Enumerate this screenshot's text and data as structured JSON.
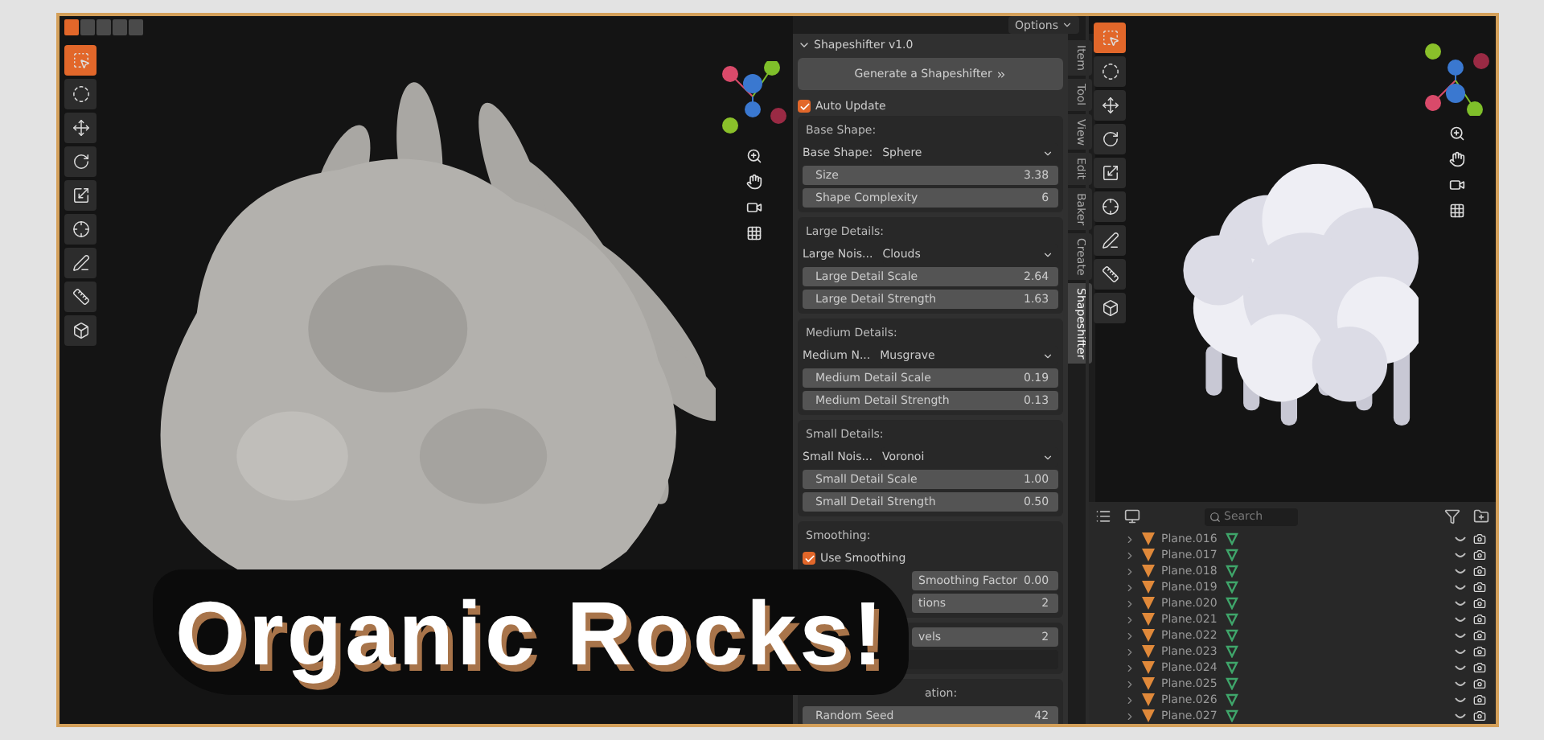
{
  "viewport_left": {
    "modes": [
      {
        "selected": true
      },
      {
        "selected": false
      },
      {
        "selected": false
      },
      {
        "selected": false
      },
      {
        "selected": false
      }
    ],
    "tools": [
      {
        "selected": true
      },
      {
        "selected": false
      },
      {
        "selected": false
      },
      {
        "selected": false
      },
      {
        "selected": false
      },
      {
        "selected": false
      },
      {
        "selected": false
      },
      {
        "selected": false
      },
      {
        "selected": false
      }
    ]
  },
  "options_button": "Options",
  "panel": {
    "title": "Shapeshifter v1.0",
    "expanded": true,
    "generate_button": "Generate a Shapeshifter",
    "auto_update": {
      "label": "Auto Update",
      "checked": true
    },
    "sections": [
      {
        "title": "Base Shape:",
        "rows": [
          {
            "kind": "dropdown",
            "label": "Base Shape:",
            "value": "Sphere"
          },
          {
            "kind": "slider",
            "label": "Size",
            "value": "3.38"
          },
          {
            "kind": "slider",
            "label": "Shape Complexity",
            "value": "6"
          }
        ]
      },
      {
        "title": "Large Details:",
        "rows": [
          {
            "kind": "dropdown",
            "label": "Large Nois...",
            "value": "Clouds"
          },
          {
            "kind": "slider",
            "label": "Large Detail Scale",
            "value": "2.64"
          },
          {
            "kind": "slider",
            "label": "Large Detail Strength",
            "value": "1.63"
          }
        ]
      },
      {
        "title": "Medium Details:",
        "rows": [
          {
            "kind": "dropdown",
            "label": "Medium N...",
            "value": "Musgrave"
          },
          {
            "kind": "slider",
            "label": "Medium Detail Scale",
            "value": "0.19"
          },
          {
            "kind": "slider",
            "label": "Medium Detail Strength",
            "value": "0.13"
          }
        ]
      },
      {
        "title": "Small Details:",
        "rows": [
          {
            "kind": "dropdown",
            "label": "Small Nois...",
            "value": "Voronoi"
          },
          {
            "kind": "slider",
            "label": "Small Detail Scale",
            "value": "1.00"
          },
          {
            "kind": "slider",
            "label": "Small Detail Strength",
            "value": "0.50"
          }
        ]
      },
      {
        "title": "Smoothing:",
        "rows": [
          {
            "kind": "checkbox",
            "label": "Use Smoothing",
            "checked": true
          },
          {
            "kind": "covered_slider",
            "label": "Smoothing Factor",
            "value": "0.00"
          },
          {
            "kind": "covered_slider",
            "label": "tions",
            "value": "2"
          }
        ]
      },
      {
        "rows": [
          {
            "kind": "covered_slider",
            "label": "vels",
            "value": "2"
          },
          {
            "kind": "blank"
          }
        ]
      },
      {
        "title": "ation:",
        "title_covered": true,
        "rows": [
          {
            "kind": "slider",
            "label": "Random Seed",
            "value": "42"
          }
        ]
      }
    ]
  },
  "side_tabs": [
    {
      "label": "Item",
      "selected": false
    },
    {
      "label": "Tool",
      "selected": false
    },
    {
      "label": "View",
      "selected": false
    },
    {
      "label": "Edit",
      "selected": false
    },
    {
      "label": "Baker",
      "selected": false
    },
    {
      "label": "Create",
      "selected": false
    },
    {
      "label": "Shapeshifter",
      "selected": true
    }
  ],
  "viewport_right": {
    "tools": [
      {
        "selected": true
      },
      {
        "selected": false
      },
      {
        "selected": false
      },
      {
        "selected": false
      },
      {
        "selected": false
      },
      {
        "selected": false
      },
      {
        "selected": false
      },
      {
        "selected": false
      },
      {
        "selected": false
      }
    ]
  },
  "outliner": {
    "search": {
      "placeholder": "Search"
    },
    "rows": [
      {
        "name": "Plane.016"
      },
      {
        "name": "Plane.017"
      },
      {
        "name": "Plane.018"
      },
      {
        "name": "Plane.019"
      },
      {
        "name": "Plane.020"
      },
      {
        "name": "Plane.021"
      },
      {
        "name": "Plane.022"
      },
      {
        "name": "Plane.023"
      },
      {
        "name": "Plane.024"
      },
      {
        "name": "Plane.025"
      },
      {
        "name": "Plane.026"
      },
      {
        "name": "Plane.027"
      }
    ]
  },
  "banner": "Organic Rocks!"
}
